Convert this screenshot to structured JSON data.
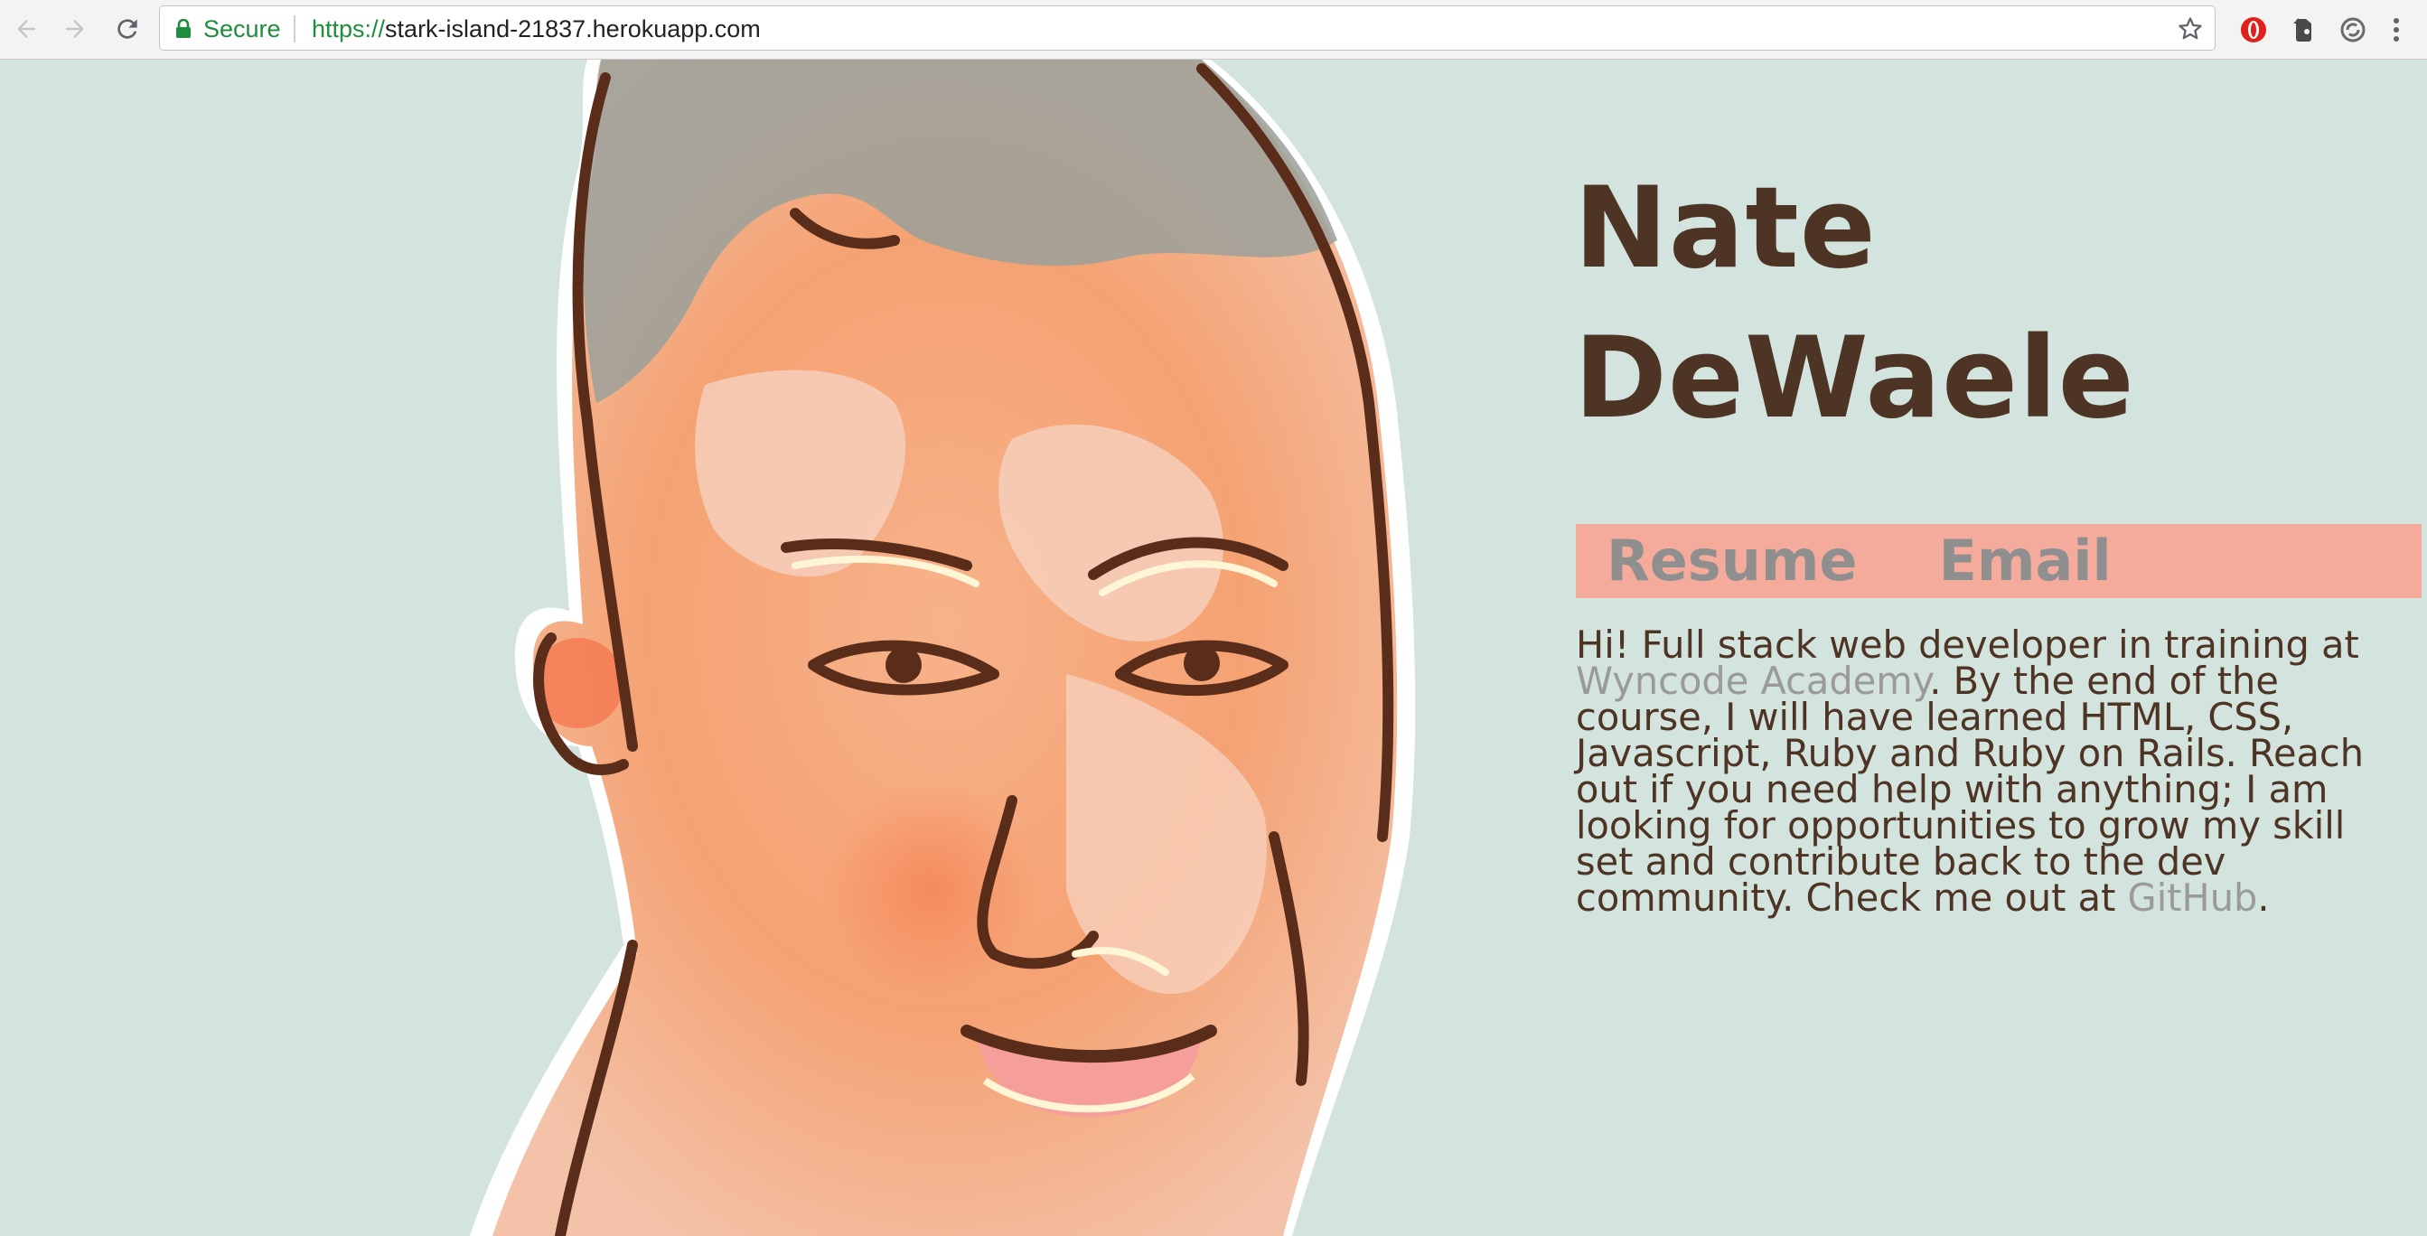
{
  "browser": {
    "secure_label": "Secure",
    "url_scheme": "https://",
    "url_host": "stark-island-21837.herokuapp.com",
    "icons": [
      "back-arrow-icon",
      "forward-arrow-icon",
      "reload-icon",
      "lock-icon",
      "star-icon",
      "opera-extension-icon",
      "evernote-extension-icon",
      "sync-extension-icon",
      "menu-dots-icon"
    ]
  },
  "hero": {
    "name_line1": "Nate",
    "name_line2": "DeWaele"
  },
  "nav": {
    "resume": "Resume",
    "email": "Email"
  },
  "bio": {
    "intro": "Hi! Full stack web developer in training at ",
    "school_link": "Wyncode Academy",
    "middle": ". By the end of the course, I will have learned HTML, CSS, Javascript, Ruby and Ruby on Rails. Reach out if you need help with anything; I am looking for opportunities to grow my skill set and contribute back to the dev community. Check me out at ",
    "github_link": "GitHub",
    "end": "."
  },
  "colors": {
    "page_background": "#d3e3dd",
    "text_brown": "#4e3424",
    "nav_bar": "#f4ab9c",
    "link_gray": "#9a9a9a",
    "secure_green": "#1e8e3e"
  }
}
